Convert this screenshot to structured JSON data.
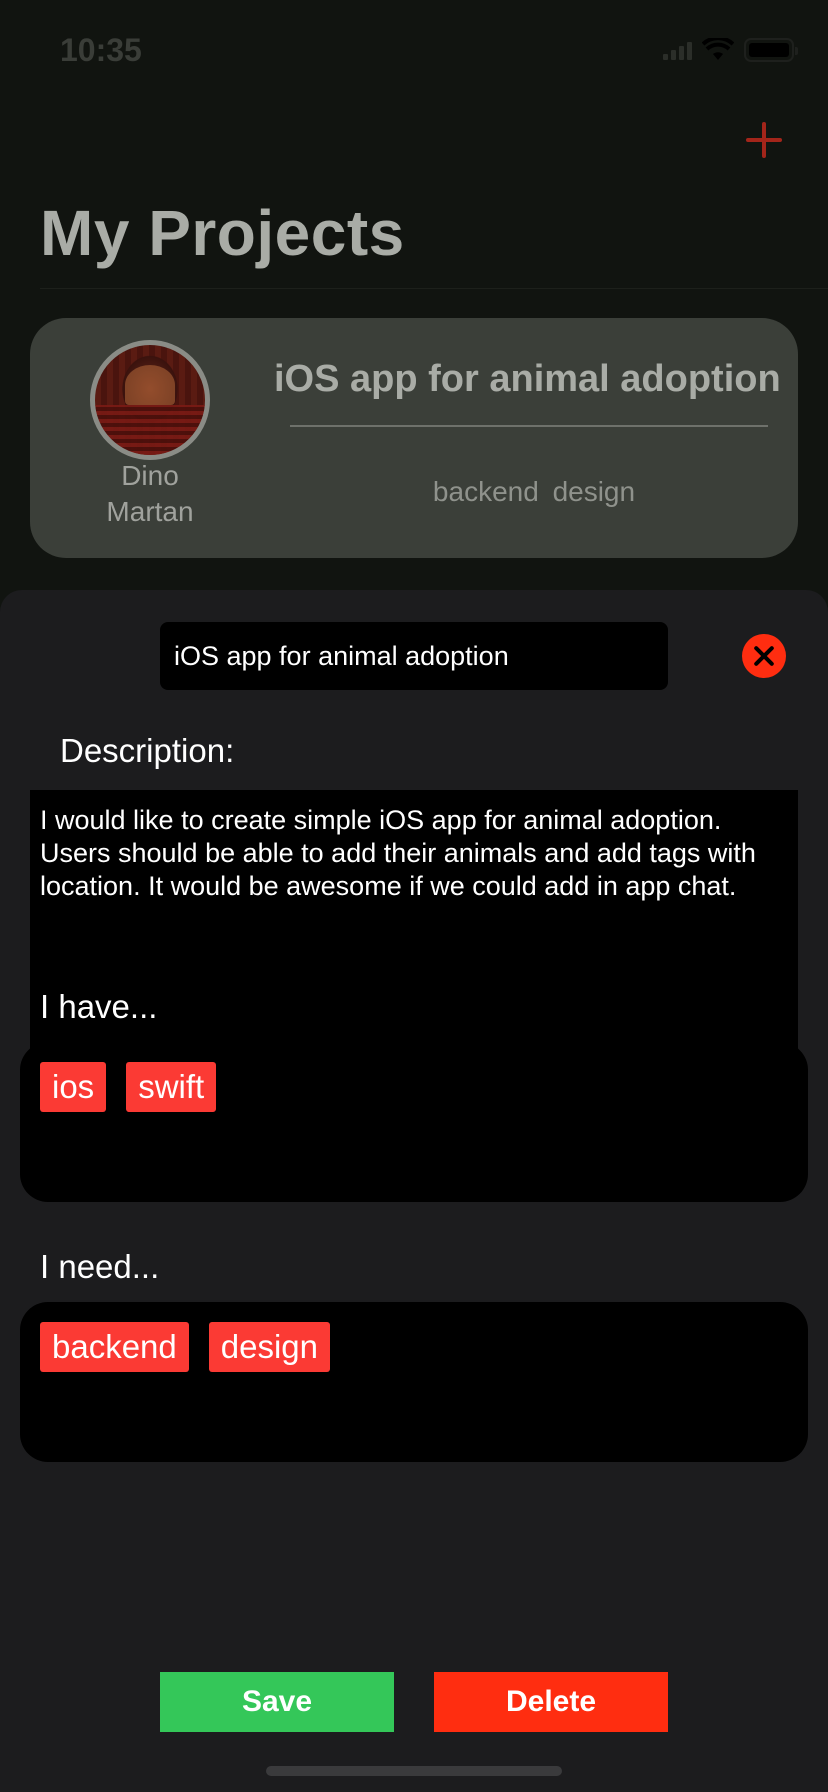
{
  "status_bar": {
    "time": "10:35"
  },
  "header": {
    "title": "My Projects"
  },
  "project_card": {
    "owner_first": "Dino",
    "owner_last": "Martan",
    "title": "iOS app for animal adoption",
    "tags": "backend  design"
  },
  "sheet": {
    "project_name": "iOS app for animal adoption",
    "description_label": "Description:",
    "description": "I would like to create simple iOS app for animal adoption. Users should be able to add their animals and add tags with location. It would be awesome if we could add in app chat.",
    "have_label": "I have...",
    "have_tags": [
      "ios",
      "swift"
    ],
    "need_label": "I need...",
    "need_tags": [
      "backend",
      "design"
    ],
    "save_label": "Save",
    "delete_label": "Delete"
  },
  "colors": {
    "accent_red": "#ff2d10",
    "tag_red": "#fb3a34",
    "save_green": "#34c759"
  }
}
